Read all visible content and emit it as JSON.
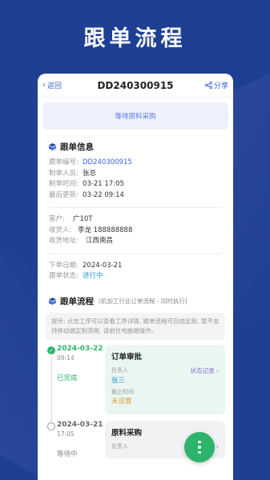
{
  "hero": {
    "title": "跟单流程"
  },
  "nav": {
    "back_label": "返回",
    "order_no": "DD240300915",
    "share_label": "分享"
  },
  "status_banner": "等待原料采购",
  "order_info": {
    "title": "跟单信息",
    "rows": [
      {
        "k": "跟单编号:",
        "v": "DD240300915"
      },
      {
        "k": "制单人员:",
        "v": "张总"
      },
      {
        "k": "制单时间:",
        "v": "03-21 17:05"
      },
      {
        "k": "最后更新:",
        "v": "03-22 09:14"
      }
    ],
    "customer_rows": [
      {
        "k": "客户:",
        "v": "广10T"
      },
      {
        "k": "收货人:",
        "v": "李龙 188888888"
      },
      {
        "k": "收货地址:",
        "v": "江西南昌"
      }
    ],
    "order_rows": [
      {
        "k": "下单日期:",
        "v": "2024-03-21"
      },
      {
        "k": "跟单状态:",
        "v": "进行中"
      }
    ]
  },
  "flow": {
    "title": "跟单流程",
    "subtitle": "(机加工行业订单流程 - 同时执行)",
    "tip": "提示: 点击工序可以查看工序详情, 跟单流程可自由定制, 暂不支持移动端定制流程, 请前往电脑端操作。",
    "steps": [
      {
        "date": "2024-03-22",
        "time": "09:14",
        "state": "已完成",
        "name": "订单审批",
        "owner_label": "负责人",
        "owner": "张三",
        "log_label": "状态记录 ›",
        "deadline_label": "截止时间",
        "deadline": "未设置"
      },
      {
        "date": "2024-03-21",
        "time": "17:05",
        "state": "等待中",
        "name": "原料采购",
        "owner_label": "负责人",
        "owner": "",
        "log_label": "状态记录 ›"
      }
    ]
  },
  "colors": {
    "brand": "#1f3f93",
    "accent": "#3a64d8",
    "done": "#2db36b"
  }
}
